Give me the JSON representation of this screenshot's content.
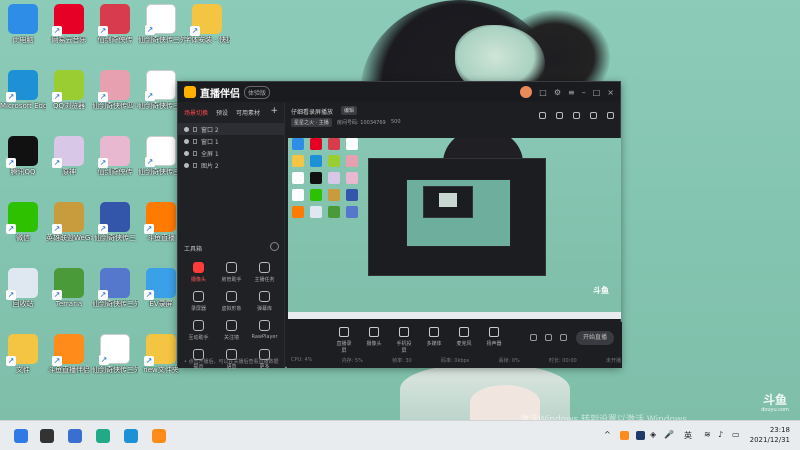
{
  "desktop": {
    "icons": [
      {
        "id": "this-pc",
        "label": "此电脑",
        "color": "#2e8de6"
      },
      {
        "id": "netease-music",
        "label": "网易云音乐",
        "color": "#e60026"
      },
      {
        "id": "xianjian-1",
        "label": "仙剑奇侠传",
        "color": "#d83b4b"
      },
      {
        "id": "doc-1",
        "label": "仙剑奇侠传三外传Chine...",
        "color": "#ffffff"
      },
      {
        "id": "folder-1",
        "label": "字体安装 - 快捷方式",
        "color": "#f4c542"
      },
      {
        "id": "edge",
        "label": "Microsoft Edge",
        "color": "#1e90d6"
      },
      {
        "id": "qq-browser",
        "label": "QQ浏览器",
        "color": "#9acd32"
      },
      {
        "id": "xianjian-4",
        "label": "仙剑奇侠传四 中文版",
        "color": "#e6a0b0"
      },
      {
        "id": "doc-2",
        "label": "仙剑奇侠传三 外传 (...",
        "color": "#ffffff"
      },
      {
        "id": "qq",
        "label": "腾讯QQ",
        "color": "#111111"
      },
      {
        "id": "genshin",
        "label": "原神",
        "color": "#d9c7e8"
      },
      {
        "id": "xianjian-2",
        "label": "仙剑奇侠传",
        "color": "#e8b8d0"
      },
      {
        "id": "doc-3",
        "label": "仙剑奇侠传三外传Chine...",
        "color": "#ffffff"
      },
      {
        "id": "wechat",
        "label": "微信",
        "color": "#2dc100"
      },
      {
        "id": "wegame-lol",
        "label": "英雄联盟WeGame版",
        "color": "#c89b3c"
      },
      {
        "id": "xianjian-3",
        "label": "仙剑奇侠传三",
        "color": "#3355aa"
      },
      {
        "id": "douyu-live",
        "label": "斗鱼直播",
        "color": "#ff7a00"
      },
      {
        "id": "recycle-bin",
        "label": "回收站",
        "color": "#dfe8f0"
      },
      {
        "id": "terraria",
        "label": "Terraria",
        "color": "#4a9a3a"
      },
      {
        "id": "xianjian-5",
        "label": "仙剑奇侠传三外传·问情篇",
        "color": "#5577cc"
      },
      {
        "id": "ev-capture",
        "label": "EV录屏",
        "color": "#3aa0e8"
      },
      {
        "id": "folder-2",
        "label": "文件",
        "color": "#f4c542"
      },
      {
        "id": "douyu-stream",
        "label": "斗鱼直播伴侣",
        "color": "#ff8c1a"
      },
      {
        "id": "doc-4",
        "label": "仙剑奇侠传三外传Chine...",
        "color": "#ffffff"
      },
      {
        "id": "folder-3",
        "label": "new文件夹",
        "color": "#f4c542"
      }
    ]
  },
  "app": {
    "title": "直播伴侣",
    "beta": "体验版",
    "left_tabs": [
      "场景切换",
      "预设",
      "可用素材"
    ],
    "add": "+",
    "scenes": [
      "窗口 2",
      "窗口 1",
      "全屏 1",
      "图片 2"
    ],
    "tools_title": "工具箱",
    "tools": [
      "摄像头",
      "房管助手",
      "主播任务",
      "录屏器",
      "虚拟形象",
      "弹幕库",
      "互动助手",
      "关注墙",
      "RawPlayer",
      "提示",
      "语音",
      "更多"
    ],
    "left_footer": "• 点击开播后，可以在关播后查看直播数据",
    "stream_title": "仔细看录屏播放",
    "edit": "编辑",
    "category": "星星之火 · 主播",
    "room_no": "房间号码: 10034769",
    "fans": "500",
    "bottom_items": [
      "直播录屏",
      "摄像头",
      "手机投屏",
      "多媒体",
      "麦克风",
      "扬声器"
    ],
    "start_live": "开始直播",
    "stats": [
      "CPU: 4%",
      "内存: 5%",
      "帧率: 30",
      "码率: 0kbps",
      "丢帧: 0%",
      "时长: 00:00",
      "未开播"
    ]
  },
  "overlay": {
    "douyu_wm": "斗鱼",
    "douyu_wm_sub": "douyu.com",
    "activation": "激活Windows 转到设置以激活 Windows。"
  },
  "taskbar": {
    "lang": "英",
    "time": "23:18",
    "date": "2021/12/31",
    "apps": [
      {
        "id": "start",
        "color": "#2f7ae5"
      },
      {
        "id": "task-view",
        "color": "#333333"
      },
      {
        "id": "nk",
        "color": "#3a6ed0"
      },
      {
        "id": "store",
        "color": "#22aa88"
      },
      {
        "id": "edge",
        "color": "#1e90d6"
      },
      {
        "id": "douyu",
        "color": "#ff8c1a"
      }
    ]
  }
}
